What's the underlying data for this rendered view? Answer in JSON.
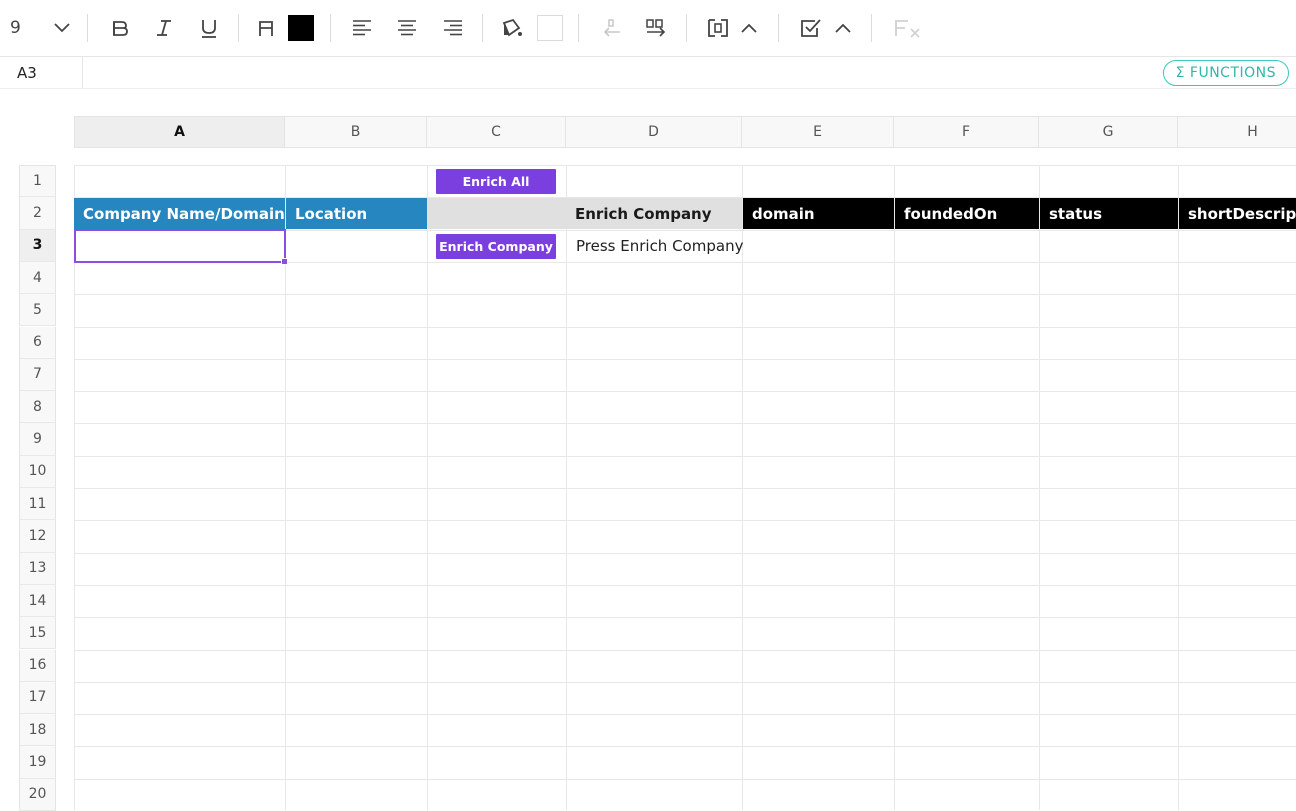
{
  "toolbar": {
    "font_size": "9",
    "text_color": "#000000",
    "fill_color": "#ffffff",
    "icons": [
      "chevron-down-icon",
      "bold-icon",
      "italic-icon",
      "underline-icon",
      "text-color-icon",
      "align-left-icon",
      "align-center-icon",
      "align-right-icon",
      "fill-color-icon",
      "insert-left-icon",
      "insert-right-icon",
      "merge-cells-icon",
      "chevron-up-icon",
      "checkbox-icon",
      "chevron-up-icon",
      "clear-format-icon"
    ]
  },
  "formula_bar": {
    "cell_ref": "A3",
    "functions_label": "Σ FUNCTIONS"
  },
  "columns": [
    "A",
    "B",
    "C",
    "D",
    "E",
    "F",
    "G",
    "H"
  ],
  "active_column": "A",
  "rows": [
    "1",
    "2",
    "3",
    "4",
    "5",
    "6",
    "7",
    "8",
    "9",
    "10",
    "11",
    "12",
    "13",
    "14",
    "15",
    "16",
    "17",
    "18",
    "19",
    "20"
  ],
  "active_row": "3",
  "sheet": {
    "enrich_all_label": "Enrich All",
    "enrich_company_button_label": "Enrich Company",
    "headers": {
      "A": "Company Name/Domain*",
      "B": "Location",
      "C": "",
      "D": "Enrich Company",
      "E": "domain",
      "F": "foundedOn",
      "G": "status",
      "H": "shortDescription"
    },
    "d3_text": "Press Enrich Company"
  },
  "colors": {
    "header_blue": "#2686c0",
    "header_grey": "#e0e0e0",
    "header_black": "#000000",
    "button_purple": "#7b3fe0",
    "functions_teal": "#2fb8a8",
    "selection": "#8b4fe0"
  }
}
